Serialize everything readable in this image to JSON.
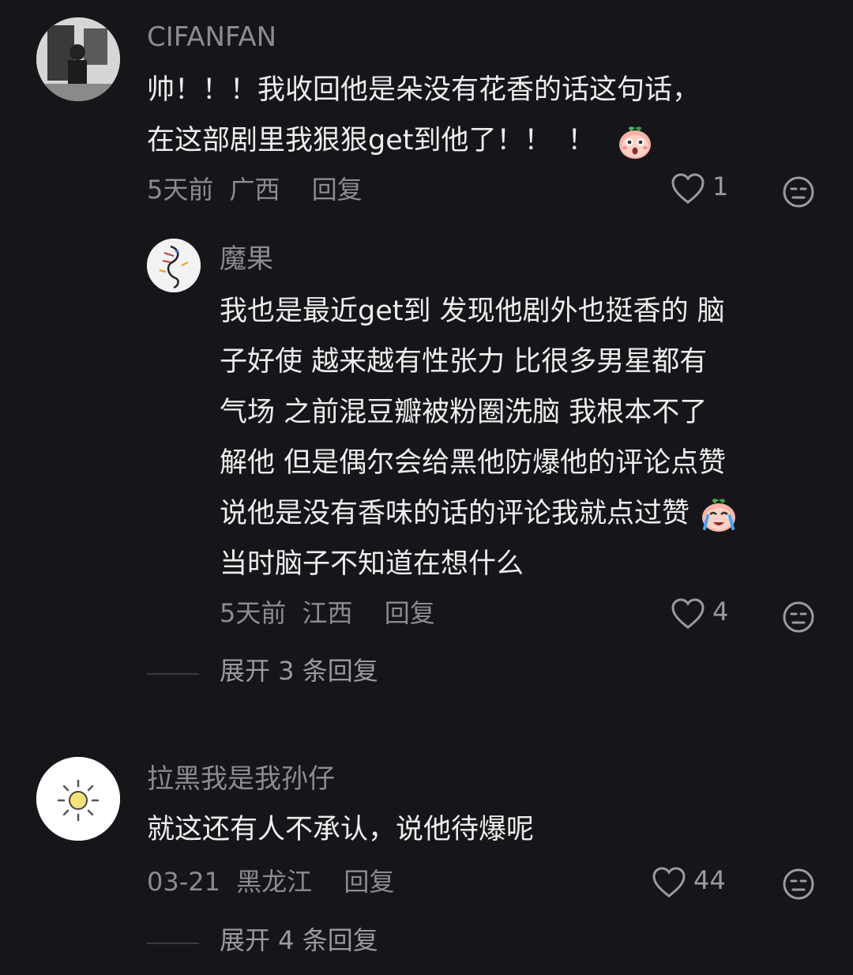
{
  "comments": [
    {
      "username": "CIFANFAN",
      "text_line1": "帅！！！我收回他是朵没有花香的话这句话，",
      "text_line2": "在这部剧里我狠狠get到他了！！",
      "date": "5天前",
      "location": "广西",
      "reply_label": "回复",
      "likes": "1",
      "emoji": "surprised-peach-emoji",
      "replies": [
        {
          "username": "魔果",
          "lines": [
            "我也是最近get到 发现他剧外也挺香的 脑",
            "子好使 越来越有性张力 比很多男星都有",
            "气场 之前混豆瓣被粉圈洗脑 我根本不了",
            "解他 但是偶尔会给黑他防爆他的评论点赞",
            "说他是没有香味的话的评论我就点过赞",
            "当时脑子不知道在想什么"
          ],
          "emoji": "crying-peach-emoji",
          "date": "5天前",
          "location": "江西",
          "reply_label": "回复",
          "likes": "4"
        }
      ],
      "expand_label": "展开 3 条回复"
    },
    {
      "username": "拉黑我是我孙仔",
      "text_line1": "就这还有人不承认，说他待爆呢",
      "date": "03-21",
      "location": "黑龙江",
      "reply_label": "回复",
      "likes": "44",
      "expand_label": "展开 4 条回复"
    }
  ],
  "icons": {
    "like": "heart-outline-icon",
    "dislike": "meh-face-icon"
  },
  "colors": {
    "background": "#16161a",
    "text": "#ededed",
    "muted": "#8b8b92"
  }
}
